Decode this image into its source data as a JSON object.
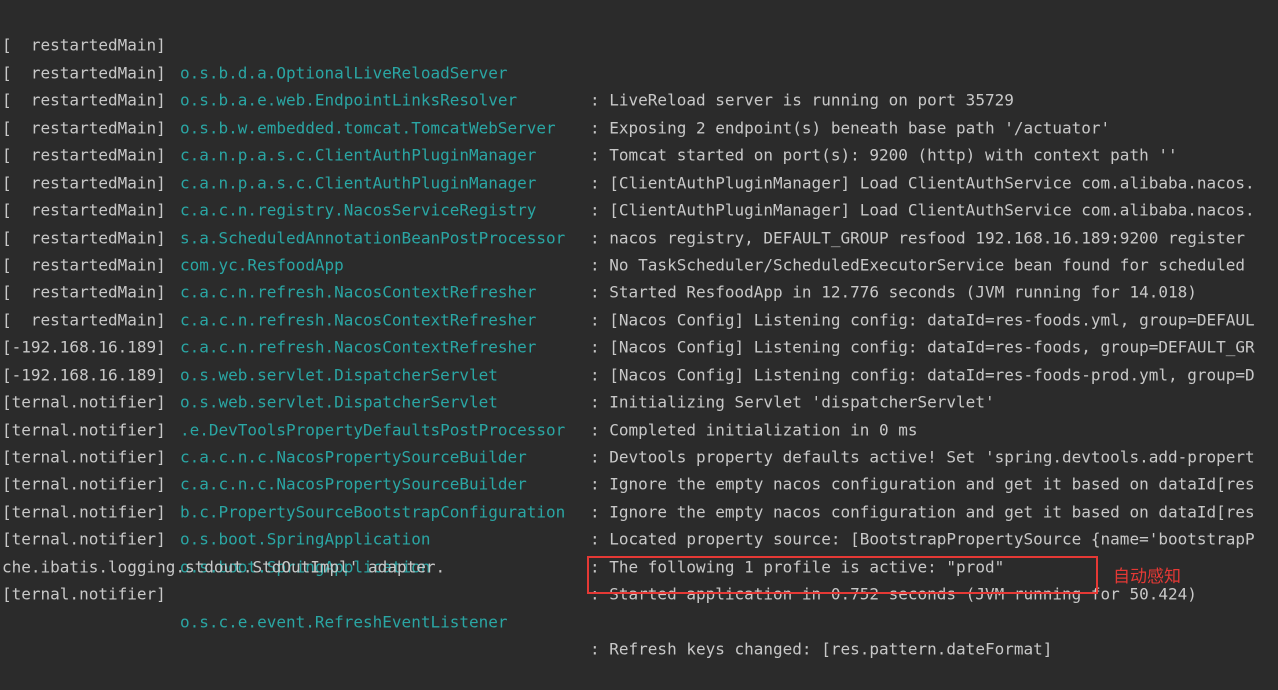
{
  "log_lines": [
    {
      "thread": "[  restartedMain]",
      "logger": "o.s.b.d.a.OptionalLiveReloadServer",
      "message": ": LiveReload server is running on port 35729"
    },
    {
      "thread": "[  restartedMain]",
      "logger": "o.s.b.a.e.web.EndpointLinksResolver",
      "message": ": Exposing 2 endpoint(s) beneath base path '/actuator'"
    },
    {
      "thread": "[  restartedMain]",
      "logger": "o.s.b.w.embedded.tomcat.TomcatWebServer",
      "message": ": Tomcat started on port(s): 9200 (http) with context path ''"
    },
    {
      "thread": "[  restartedMain]",
      "logger": "c.a.n.p.a.s.c.ClientAuthPluginManager",
      "message": ": [ClientAuthPluginManager] Load ClientAuthService com.alibaba.nacos."
    },
    {
      "thread": "[  restartedMain]",
      "logger": "c.a.n.p.a.s.c.ClientAuthPluginManager",
      "message": ": [ClientAuthPluginManager] Load ClientAuthService com.alibaba.nacos."
    },
    {
      "thread": "[  restartedMain]",
      "logger": "c.a.c.n.registry.NacosServiceRegistry",
      "message": ": nacos registry, DEFAULT_GROUP resfood 192.168.16.189:9200 register"
    },
    {
      "thread": "[  restartedMain]",
      "logger": "s.a.ScheduledAnnotationBeanPostProcessor",
      "message": ": No TaskScheduler/ScheduledExecutorService bean found for scheduled"
    },
    {
      "thread": "[  restartedMain]",
      "logger": "com.yc.ResfoodApp",
      "message": ": Started ResfoodApp in 12.776 seconds (JVM running for 14.018)"
    },
    {
      "thread": "[  restartedMain]",
      "logger": "c.a.c.n.refresh.NacosContextRefresher",
      "message": ": [Nacos Config] Listening config: dataId=res-foods.yml, group=DEFAUL"
    },
    {
      "thread": "[  restartedMain]",
      "logger": "c.a.c.n.refresh.NacosContextRefresher",
      "message": ": [Nacos Config] Listening config: dataId=res-foods, group=DEFAULT_GR"
    },
    {
      "thread": "[  restartedMain]",
      "logger": "c.a.c.n.refresh.NacosContextRefresher",
      "message": ": [Nacos Config] Listening config: dataId=res-foods-prod.yml, group=D"
    },
    {
      "thread": "[-192.168.16.189]",
      "logger": "o.s.web.servlet.DispatcherServlet",
      "message": ": Initializing Servlet 'dispatcherServlet'"
    },
    {
      "thread": "[-192.168.16.189]",
      "logger": "o.s.web.servlet.DispatcherServlet",
      "message": ": Completed initialization in 0 ms"
    },
    {
      "thread": "[ternal.notifier]",
      "logger": ".e.DevToolsPropertyDefaultsPostProcessor",
      "message": ": Devtools property defaults active! Set 'spring.devtools.add-propert"
    },
    {
      "thread": "[ternal.notifier]",
      "logger": "c.a.c.n.c.NacosPropertySourceBuilder",
      "message": ": Ignore the empty nacos configuration and get it based on dataId[res"
    },
    {
      "thread": "[ternal.notifier]",
      "logger": "c.a.c.n.c.NacosPropertySourceBuilder",
      "message": ": Ignore the empty nacos configuration and get it based on dataId[res"
    },
    {
      "thread": "[ternal.notifier]",
      "logger": "b.c.PropertySourceBootstrapConfiguration",
      "message": ": Located property source: [BootstrapPropertySource {name='bootstrapP"
    },
    {
      "thread": "[ternal.notifier]",
      "logger": "o.s.boot.SpringApplication",
      "message": ": The following 1 profile is active: \"prod\""
    },
    {
      "thread": "[ternal.notifier]",
      "logger": "o.s.boot.SpringApplication",
      "message": ": Started application in 0.752 seconds (JVM running for 50.424)"
    },
    {
      "full": "che.ibatis.logging.stdout.StdOutImpl' adapter."
    },
    {
      "thread": "[ternal.notifier]",
      "logger": "o.s.c.e.event.RefreshEventListener",
      "message": ": Refresh keys changed: [res.pattern.dateFormat]"
    }
  ],
  "annotation": {
    "text": "自动感知",
    "color": "#e53935"
  },
  "colors": {
    "background": "#2b2b2b",
    "text": "#c8c8c8",
    "logger": "#2aa6a4"
  }
}
